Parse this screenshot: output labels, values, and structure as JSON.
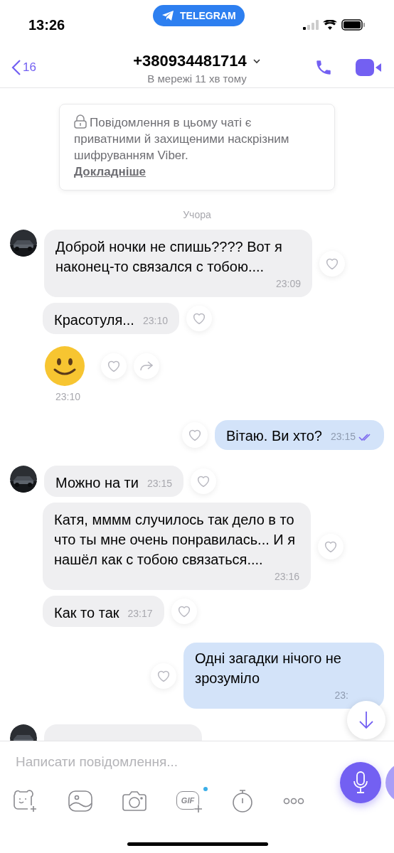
{
  "status_bar": {
    "time": "13:26",
    "return_app": "TELEGRAM"
  },
  "header": {
    "back_count": "16",
    "title": "+380934481714",
    "subtitle": "В мережі 11 хв тому"
  },
  "notice": {
    "text": "Повідомлення в цьому чаті є приватними й захищеними наскрізним шифруванням Viber.",
    "link": "Докладніше"
  },
  "date_divider": "Учора",
  "messages": [
    {
      "kind": "incoming",
      "avatar": true,
      "text": "Доброй ночки не спишь???? Вот я наконец-то связался с тобою....",
      "time": "23:09"
    },
    {
      "kind": "incoming",
      "avatar": false,
      "text": "Красотуля...",
      "time": "23:10"
    },
    {
      "kind": "sticker",
      "avatar": false,
      "time": "23:10"
    },
    {
      "kind": "outgoing",
      "text": "Вітаю. Ви хто?",
      "time": "23:15",
      "read": true
    },
    {
      "kind": "incoming",
      "avatar": true,
      "text": "Можно на ти",
      "time": "23:15"
    },
    {
      "kind": "incoming",
      "avatar": false,
      "text": "Катя, мммм случилось так дело в то что ты мне очень понравилась... И я нашёл как с тобою связаться....",
      "time": "23:16"
    },
    {
      "kind": "incoming",
      "avatar": false,
      "text": "Как то так",
      "time": "23:17"
    },
    {
      "kind": "outgoing",
      "text": "Одні загадки нічого не зрозуміло",
      "time": "23:",
      "read": false
    },
    {
      "kind": "partial",
      "avatar": true
    }
  ],
  "composer": {
    "placeholder": "Написати повідомлення...",
    "gif_label": "GIF"
  }
}
